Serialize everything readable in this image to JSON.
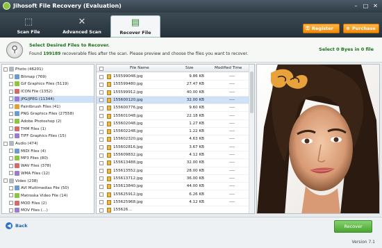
{
  "window": {
    "title": "Jihosoft File Recovery (Evaluation)"
  },
  "toolbar": {
    "tabs": [
      {
        "label": "Scan File",
        "icon": "search-file-icon"
      },
      {
        "label": "Advanced Scan",
        "icon": "tools-icon"
      },
      {
        "label": "Recover File",
        "icon": "recover-file-icon"
      }
    ],
    "register_label": "Register",
    "purchase_label": "Purchase",
    "accent_color": "#f39c1c"
  },
  "info": {
    "heading": "Select Desired Files to Recover.",
    "found_prefix": "Found",
    "found_count": "199189",
    "found_suffix": "recoverable files after the scan. Please preview and choose the files you want to recover.",
    "selection_status": "Select 0 Byes in 0 file"
  },
  "tree": [
    {
      "label": "Photo (46201)",
      "level": 0,
      "selected": false
    },
    {
      "label": "Bitmap (769)",
      "level": 1,
      "selected": false
    },
    {
      "label": "Gif Graphics Files (5119)",
      "level": 1,
      "selected": false
    },
    {
      "label": "ICON File (1352)",
      "level": 1,
      "selected": false
    },
    {
      "label": "JPG/JPEG (11344)",
      "level": 1,
      "selected": true
    },
    {
      "label": "Paintbrush Files (41)",
      "level": 1,
      "selected": false
    },
    {
      "label": "PNG Graphics Files (27558)",
      "level": 1,
      "selected": false
    },
    {
      "label": "Adobe Photoshop (2)",
      "level": 1,
      "selected": false
    },
    {
      "label": "THM Files (1)",
      "level": 1,
      "selected": false
    },
    {
      "label": "TIFF Graphics Files (15)",
      "level": 1,
      "selected": false
    },
    {
      "label": "Audio (474)",
      "level": 0,
      "selected": false
    },
    {
      "label": "MIDI Files (4)",
      "level": 1,
      "selected": false
    },
    {
      "label": "MP3 Files (80)",
      "level": 1,
      "selected": false
    },
    {
      "label": "WAV Files (378)",
      "level": 1,
      "selected": false
    },
    {
      "label": "WMA Files (12)",
      "level": 1,
      "selected": false
    },
    {
      "label": "Video (238)",
      "level": 0,
      "selected": false
    },
    {
      "label": "AVI Multimedias File (50)",
      "level": 1,
      "selected": false
    },
    {
      "label": "Matroska Video File (14)",
      "level": 1,
      "selected": false
    },
    {
      "label": "MOD Files (2)",
      "level": 1,
      "selected": false
    },
    {
      "label": "MOV Files (…)",
      "level": 1,
      "selected": false
    }
  ],
  "file_table": {
    "headers": [
      "File Name",
      "Size",
      "Modified Time"
    ],
    "rows": [
      {
        "name": "155599048.jpg",
        "size": "9.86 KB",
        "time": "----",
        "selected": false
      },
      {
        "name": "155599480.jpg",
        "size": "27.47 KB",
        "time": "----",
        "selected": false
      },
      {
        "name": "155599912.jpg",
        "size": "40.00 KB",
        "time": "----",
        "selected": false
      },
      {
        "name": "155600120.jpg",
        "size": "32.00 KB",
        "time": "----",
        "selected": true
      },
      {
        "name": "155600776.jpg",
        "size": "9.60 KB",
        "time": "----",
        "selected": false
      },
      {
        "name": "155601048.jpg",
        "size": "22.18 KB",
        "time": "----",
        "selected": false
      },
      {
        "name": "155602048.jpg",
        "size": "1.27 KB",
        "time": "----",
        "selected": false
      },
      {
        "name": "155602248.jpg",
        "size": "1.22 KB",
        "time": "----",
        "selected": false
      },
      {
        "name": "155602320.jpg",
        "size": "4.63 KB",
        "time": "----",
        "selected": false
      },
      {
        "name": "155602816.jpg",
        "size": "3.67 KB",
        "time": "----",
        "selected": false
      },
      {
        "name": "155609832.jpg",
        "size": "4.12 KB",
        "time": "----",
        "selected": false
      },
      {
        "name": "155613488.jpg",
        "size": "32.00 KB",
        "time": "----",
        "selected": false
      },
      {
        "name": "155613552.jpg",
        "size": "28.00 KB",
        "time": "----",
        "selected": false
      },
      {
        "name": "155613712.jpg",
        "size": "36.00 KB",
        "time": "----",
        "selected": false
      },
      {
        "name": "155613840.jpg",
        "size": "44.00 KB",
        "time": "----",
        "selected": false
      },
      {
        "name": "155625912.jpg",
        "size": "6.26 KB",
        "time": "----",
        "selected": false
      },
      {
        "name": "155625968.jpg",
        "size": "4.12 KB",
        "time": "----",
        "selected": false
      },
      {
        "name": "155626…",
        "size": "",
        "time": "",
        "selected": false
      }
    ]
  },
  "bottom": {
    "back_label": "Back",
    "recover_label": "Recover",
    "version": "Version 7.1"
  }
}
